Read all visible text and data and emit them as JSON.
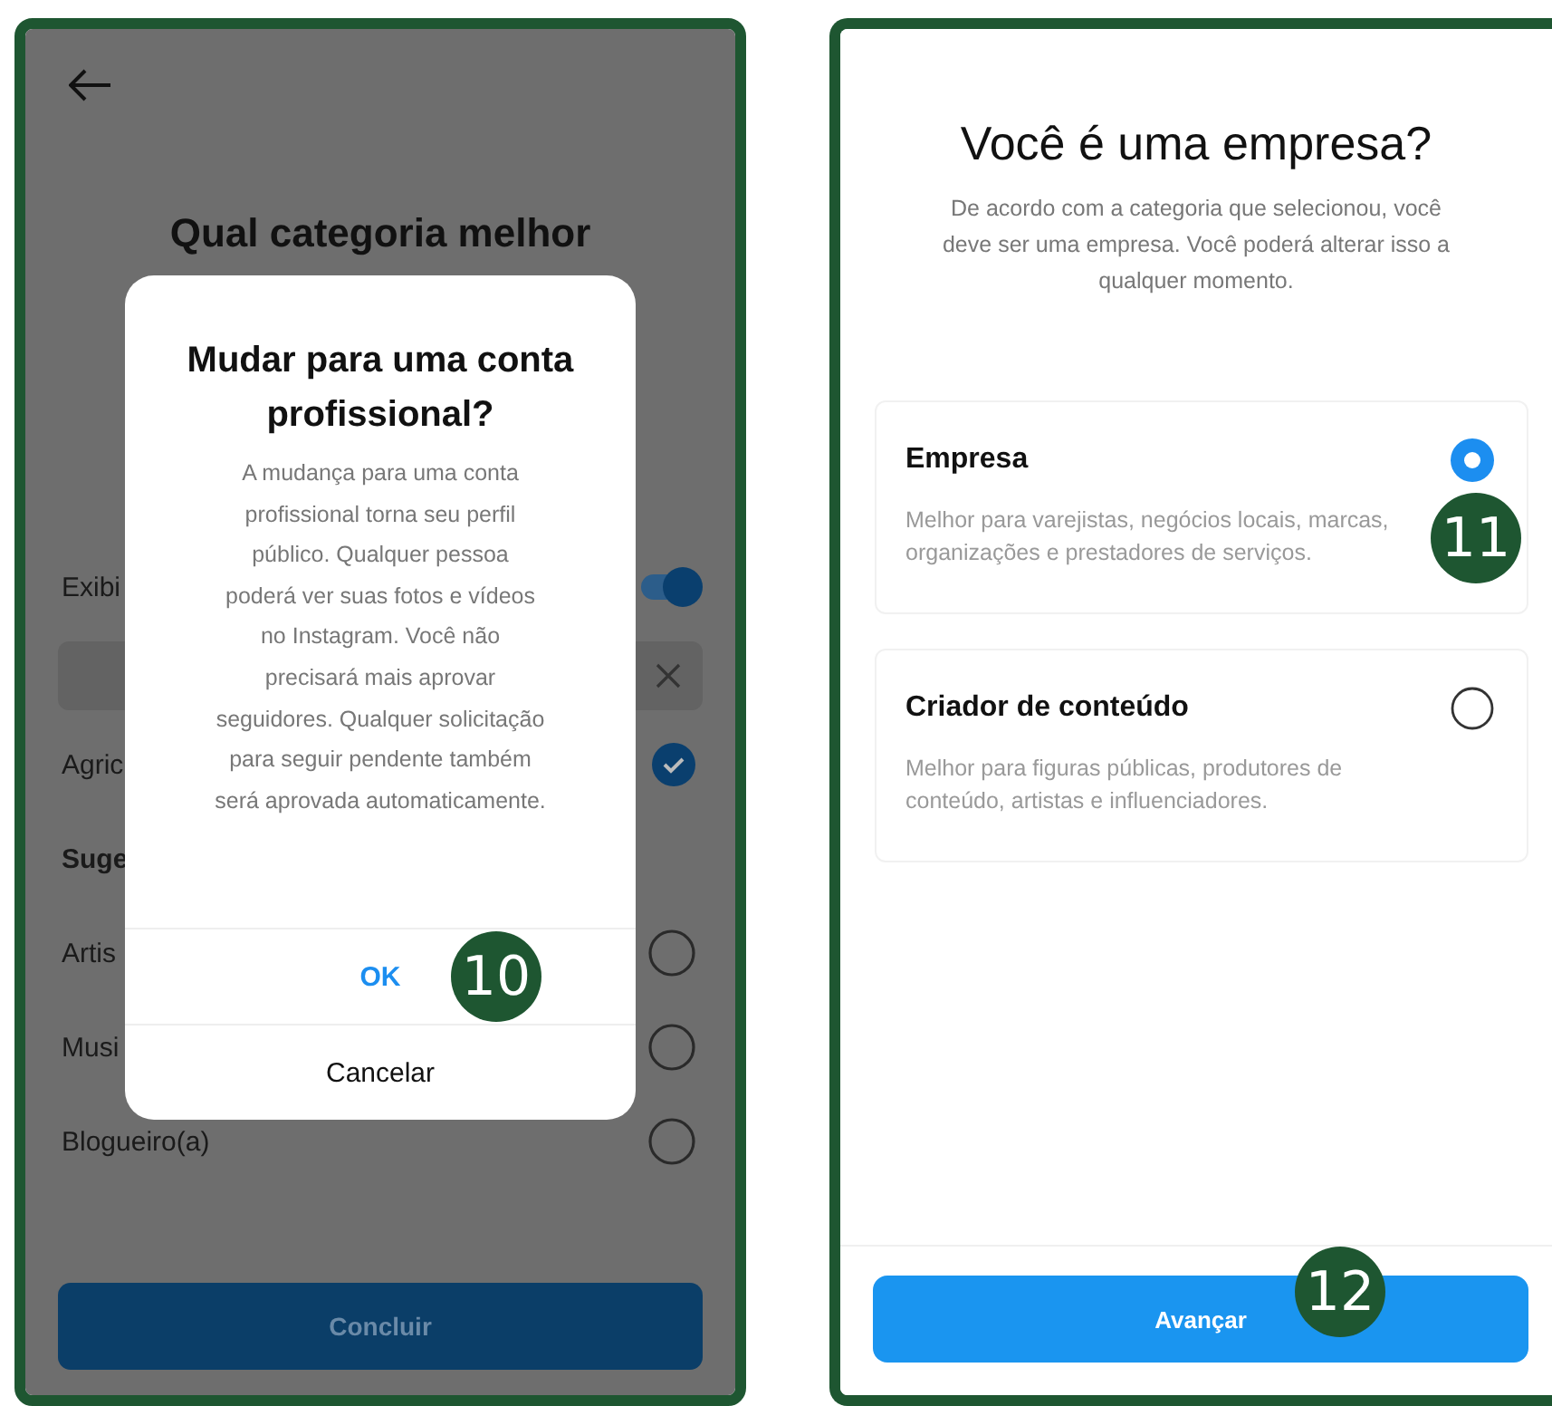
{
  "left_screen": {
    "heading": "Qual categoria melhor",
    "rows": [
      {
        "kind": "toggle",
        "label": "Exibi",
        "on": true
      },
      {
        "kind": "search"
      },
      {
        "kind": "checkbox",
        "label": "Agric",
        "checked": true
      },
      {
        "kind": "header",
        "label": "Suge"
      },
      {
        "kind": "radio",
        "label": "Artis",
        "selected": false
      },
      {
        "kind": "radio",
        "label": "Musi",
        "selected": false
      },
      {
        "kind": "radio",
        "label": "Blogueiro(a)",
        "selected": false
      }
    ],
    "button": "Concluir"
  },
  "dialog": {
    "title": "Mudar para uma conta profissional?",
    "body": "A mudança para uma conta profissional torna seu perfil público. Qualquer pessoa poderá ver suas fotos e vídeos no Instagram. Você não precisará mais aprovar seguidores. Qualquer solicitação para seguir pendente também será aprovada automaticamente.",
    "buttons": [
      {
        "kind": "primary",
        "label": "OK",
        "badge": "10"
      },
      {
        "kind": "secondary",
        "label": "Cancelar"
      }
    ]
  },
  "right_screen": {
    "title": "Você é uma empresa?",
    "subtitle": "De acordo com a categoria que selecionou, você deve ser uma empresa. Você poderá alterar isso a qualquer momento.",
    "options": [
      {
        "title": "Empresa",
        "description": "Melhor para varejistas, negócios locais, marcas, organizações e prestadores de serviços.",
        "selected": true,
        "badge": "11"
      },
      {
        "title": "Criador de conteúdo",
        "description": "Melhor para figuras públicas, produtores de conteúdo, artistas e influenciadores.",
        "selected": false
      }
    ],
    "button": {
      "label": "Avançar",
      "badge": "12"
    }
  }
}
